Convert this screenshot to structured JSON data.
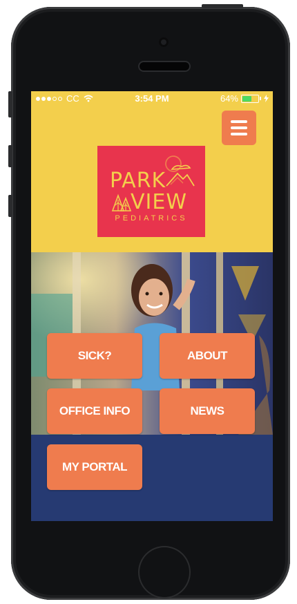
{
  "status_bar": {
    "carrier": "CC",
    "time": "3:54 PM",
    "battery": "64%",
    "battery_level": 0.64,
    "signal_bars_filled": 3,
    "signal_bars_total": 5
  },
  "header": {
    "menu_icon": "hamburger-icon"
  },
  "logo": {
    "line1": "PARK",
    "line2": "VIEW",
    "subtitle": "PEDIATRICS"
  },
  "tiles": [
    {
      "label": "SICK?"
    },
    {
      "label": "ABOUT"
    },
    {
      "label": "OFFICE INFO"
    },
    {
      "label": "NEWS"
    },
    {
      "label": "MY PORTAL"
    }
  ],
  "colors": {
    "header_bg": "#f3cf4c",
    "accent": "#ef7c4e",
    "logo_bg": "#e8344d",
    "footer_bg": "#263a72"
  }
}
